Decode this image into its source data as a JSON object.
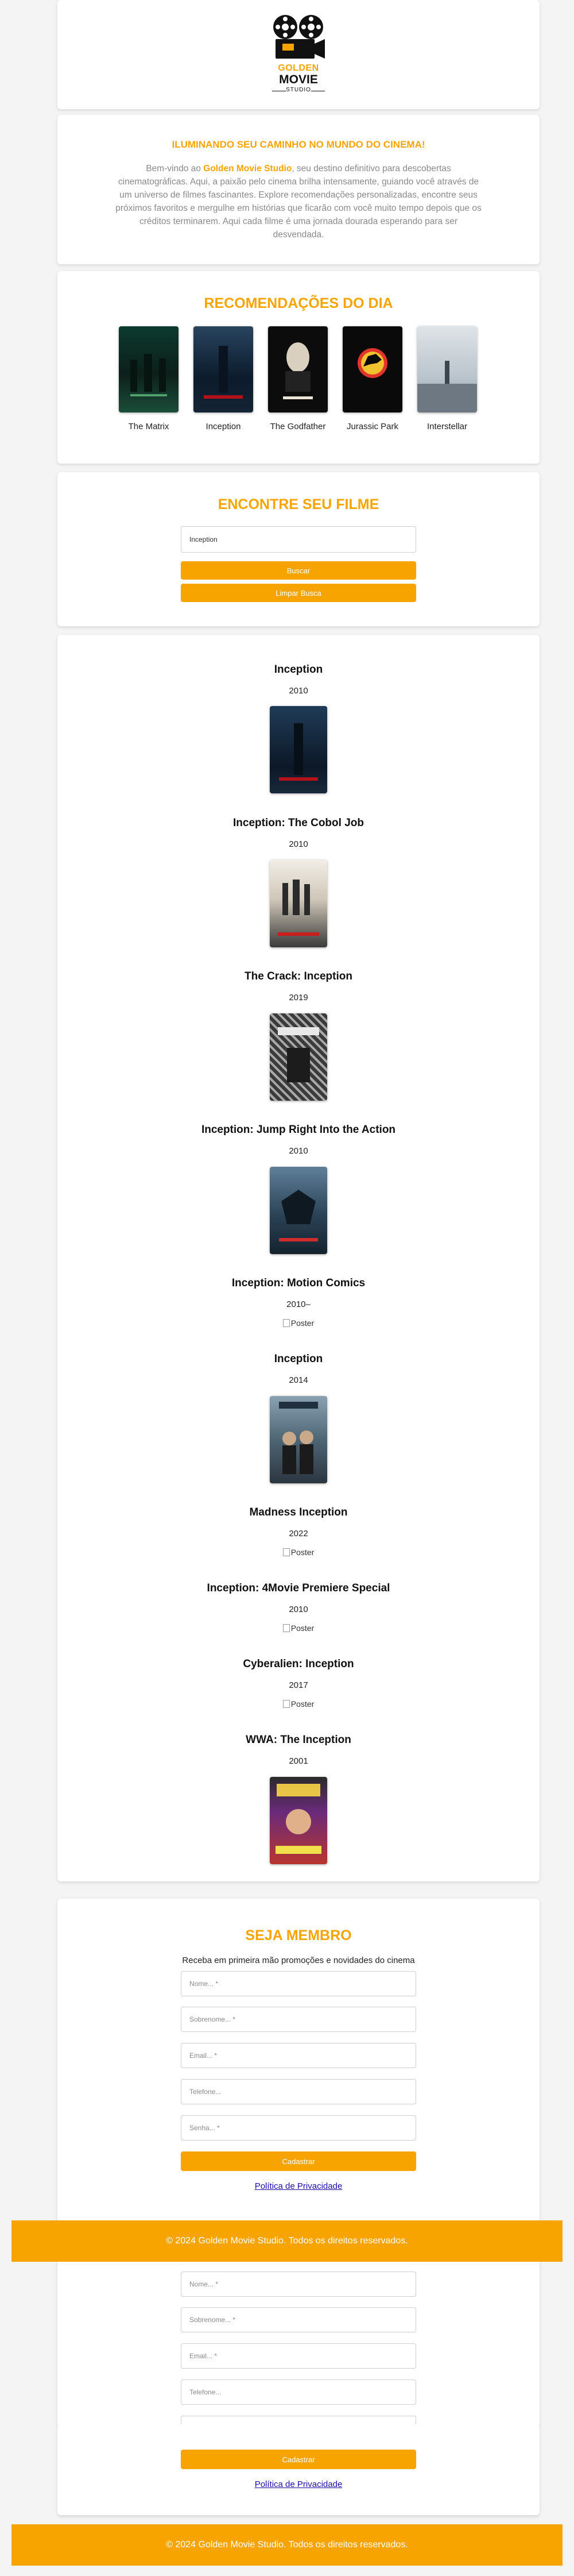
{
  "brand": {
    "line1": "GOLDEN",
    "line2": "MOVIE",
    "line3": "STUDIO"
  },
  "intro": {
    "heading": "ILUMINANDO SEU CAMINHO NO MUNDO DO CINEMA!",
    "text_before": "Bem-vindo ao ",
    "brand_name": "Golden Movie Studio",
    "text_after": ", seu destino definitivo para descobertas cinematográficas. Aqui, a paixão pelo cinema brilha intensamente, guiando você através de um universo de filmes fascinantes. Explore recomendações personalizadas, encontre seus próximos favoritos e mergulhe em histórias que ficarão com você muito tempo depois que os créditos terminarem. Aqui cada filme é uma jornada dourada esperando para ser desvendada."
  },
  "recommendations": {
    "title": "RECOMENDAÇÕES DO DIA",
    "items": [
      {
        "label": "The Matrix"
      },
      {
        "label": "Inception"
      },
      {
        "label": "The Godfather"
      },
      {
        "label": "Jurassic Park"
      },
      {
        "label": "Interstellar"
      }
    ]
  },
  "search": {
    "title": "ENCONTRE SEU FILME",
    "value": "Inception",
    "search_button": "Buscar",
    "clear_button": "Limpar Busca"
  },
  "results": [
    {
      "title": "Inception",
      "year": "2010",
      "poster": true
    },
    {
      "title": "Inception: The Cobol Job",
      "year": "2010",
      "poster": true
    },
    {
      "title": "The Crack: Inception",
      "year": "2019",
      "poster": true
    },
    {
      "title": "Inception: Jump Right Into the Action",
      "year": "2010",
      "poster": true
    },
    {
      "title": "Inception: Motion Comics",
      "year": "2010–",
      "poster": false,
      "alt": "Poster"
    },
    {
      "title": "Inception",
      "year": "2014",
      "poster": true
    },
    {
      "title": "Madness Inception",
      "year": "2022",
      "poster": false,
      "alt": "Poster"
    },
    {
      "title": "Inception: 4Movie Premiere Special",
      "year": "2010",
      "poster": false,
      "alt": "Poster"
    },
    {
      "title": "Cyberalien: Inception",
      "year": "2017",
      "poster": false,
      "alt": "Poster"
    },
    {
      "title": "WWA: The Inception",
      "year": "2001",
      "poster": true
    }
  ],
  "membership": {
    "title": "SEJA MEMBRO",
    "subtitle": "Receba em primeira mão promoções e novidades do cinema",
    "name_placeholder": "Nome... *",
    "surname_placeholder": "Sobrenome... *",
    "email_placeholder": "Email... *",
    "phone_placeholder": "Telefone...",
    "password_placeholder": "Senha... *",
    "submit_button": "Cadastrar",
    "privacy_link": "Política de Privacidade"
  },
  "footer": {
    "text": "© 2024 Golden Movie Studio. Todos os direitos reservados."
  },
  "colors": {
    "accent": "#f7a400",
    "background": "#f4f4f4",
    "link": "#1a0dab"
  }
}
